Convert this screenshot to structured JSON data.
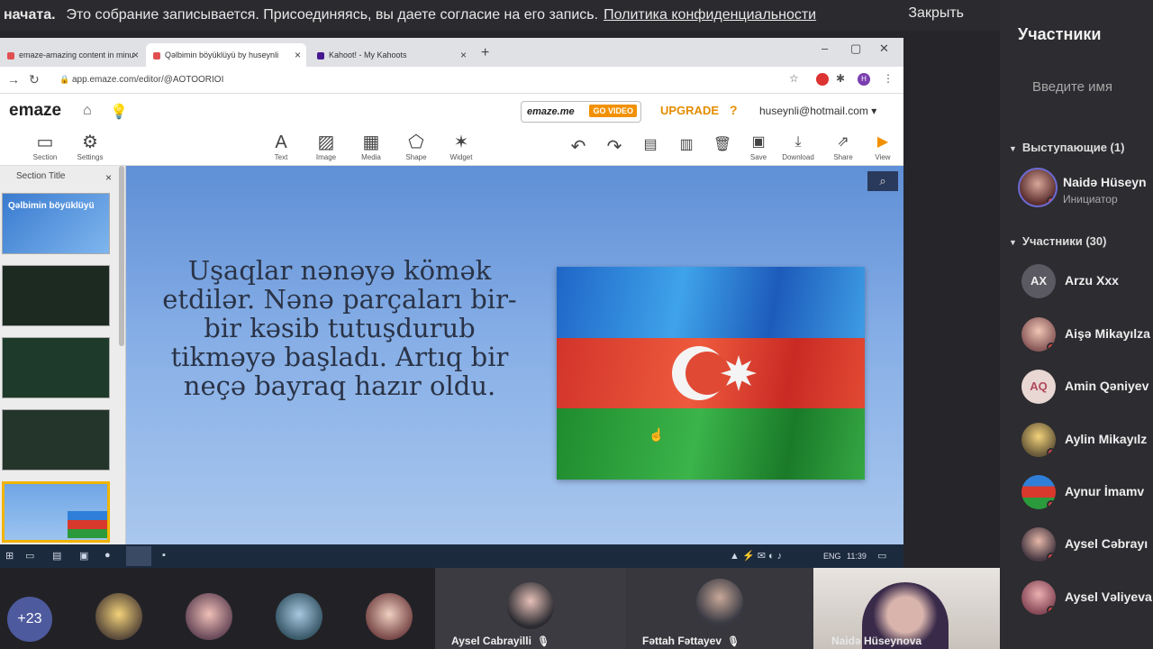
{
  "banner": {
    "prefix": "начата.",
    "message": "Это собрание записывается. Присоединяясь, вы даете согласие на его запись.",
    "policy_link": "Политика конфиденциальности",
    "close_label": "Закрыть"
  },
  "browser": {
    "tabs": [
      {
        "label": "emaze-amazing content in minu",
        "close": "×"
      },
      {
        "label": "Qəlbimin böyüklüyü by huseynli",
        "close": "×"
      },
      {
        "label": "Kahoot! - My Kahoots",
        "close": "×"
      }
    ],
    "new_tab": "+",
    "url": "app.emaze.com/editor/@AOTOORIOI",
    "account_initial": "H"
  },
  "emaze": {
    "logo": "emaze",
    "badge": "emaze.me",
    "badge_go": "GO VIDEO",
    "upgrade": "UPGRADE",
    "help": "?",
    "account": "huseynli@hotmail.com ▾"
  },
  "toolbar": {
    "left": [
      {
        "label": "Section"
      },
      {
        "label": "Settings"
      }
    ],
    "insert": [
      {
        "label": "Text"
      },
      {
        "label": "Image"
      },
      {
        "label": "Media"
      },
      {
        "label": "Shape"
      },
      {
        "label": "Widget"
      }
    ],
    "actions": [
      {
        "label": "Save"
      },
      {
        "label": "Download"
      },
      {
        "label": "Share"
      },
      {
        "label": "View"
      }
    ]
  },
  "sidebar": {
    "section_title": "Section Title",
    "first_thumb_title": "Qəlbimin böyüklüyü"
  },
  "slide": {
    "lines": [
      "Uşaqlar nənəyə kömək",
      "etdilər. Nənə parçaları bir-",
      "bir kəsib tutuşdurub",
      "tikməyə başladı. Artıq bir",
      "neçə bayraq hazır oldu."
    ]
  },
  "taskbar": {
    "lang": "ENG",
    "time": "11:39"
  },
  "participants": {
    "header": "Участники",
    "search_placeholder": "Введите имя",
    "presenters_label": "Выступающие (1)",
    "presenter": {
      "name": "Naidə Hüseyn",
      "role": "Инициатор"
    },
    "attendees_label": "Участники (30)",
    "list": [
      {
        "initials": "AX",
        "name": "Arzu Xxx"
      },
      {
        "initials": "",
        "name": "Aişə Mikayılza"
      },
      {
        "initials": "AQ",
        "name": "Amin Qəniyev"
      },
      {
        "initials": "",
        "name": "Aylin Mikayılz"
      },
      {
        "initials": "",
        "name": "Aynur İmamv"
      },
      {
        "initials": "",
        "name": "Aysel Cəbrayı"
      },
      {
        "initials": "",
        "name": "Aysel Vəliyeva"
      }
    ]
  },
  "gallery": {
    "more": "+23",
    "tiles": [
      {
        "name": "Aysel Cabrayilli"
      },
      {
        "name": "Fəttah Fəttayev"
      },
      {
        "name": "Naidə Hüseynova"
      }
    ]
  },
  "colors": {
    "accent": "#f29100",
    "presenter_ring": "#6b6bd6",
    "status_dot": "#d64545"
  }
}
